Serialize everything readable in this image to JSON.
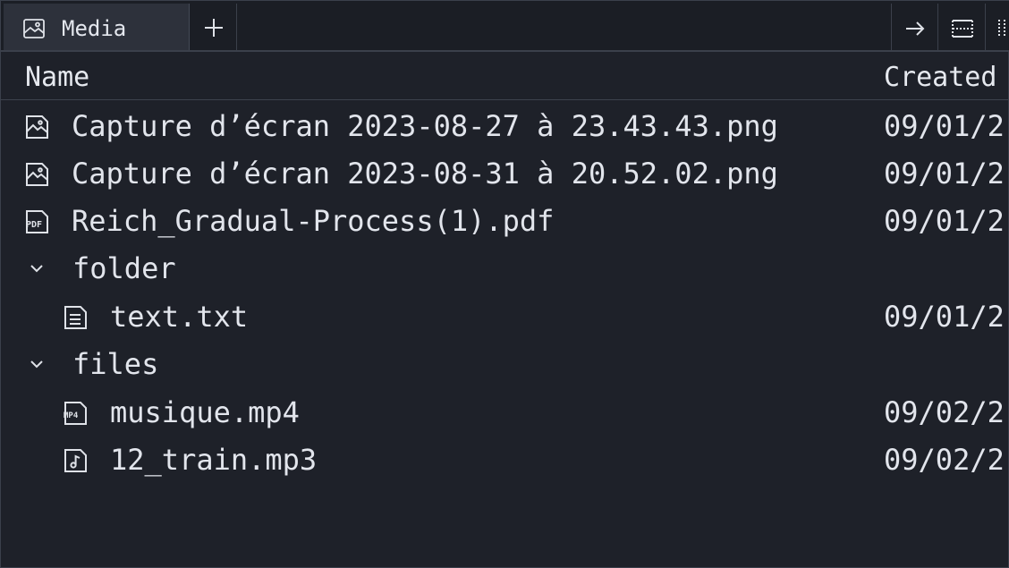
{
  "tab": {
    "label": "Media",
    "icon": "image-icon"
  },
  "toolbar": {
    "new_tab_icon": "plus-icon",
    "go_icon": "arrow-right-icon",
    "split_h_icon": "split-horizontal-icon",
    "split_v_icon": "split-vertical-icon"
  },
  "columns": {
    "name": "Name",
    "created": "Created"
  },
  "rows": [
    {
      "name": "Capture d’écran 2023-08-27 à 23.43.43.png",
      "created": "09/01/2",
      "icon": "image-file-icon",
      "kind": "file",
      "depth": 0
    },
    {
      "name": "Capture d’écran 2023-08-31 à 20.52.02.png",
      "created": "09/01/2",
      "icon": "image-file-icon",
      "kind": "file",
      "depth": 0
    },
    {
      "name": "Reich_Gradual-Process(1).pdf",
      "created": "09/01/2",
      "icon": "pdf-file-icon",
      "kind": "file",
      "depth": 0
    },
    {
      "name": "folder",
      "created": "",
      "icon": "chevron-down-icon",
      "kind": "folder",
      "depth": 0
    },
    {
      "name": "text.txt",
      "created": "09/01/2",
      "icon": "text-file-icon",
      "kind": "file",
      "depth": 1
    },
    {
      "name": "files",
      "created": "",
      "icon": "chevron-down-icon",
      "kind": "folder",
      "depth": 0
    },
    {
      "name": "musique.mp4",
      "created": "09/02/2",
      "icon": "mp4-file-icon",
      "kind": "file",
      "depth": 1
    },
    {
      "name": "12_train.mp3",
      "created": "09/02/2",
      "icon": "audio-file-icon",
      "kind": "file",
      "depth": 1
    }
  ],
  "colors": {
    "background": "#1e2129",
    "tab_active": "#2d313b",
    "text": "#e2e5ec",
    "border": "#3b404b"
  }
}
